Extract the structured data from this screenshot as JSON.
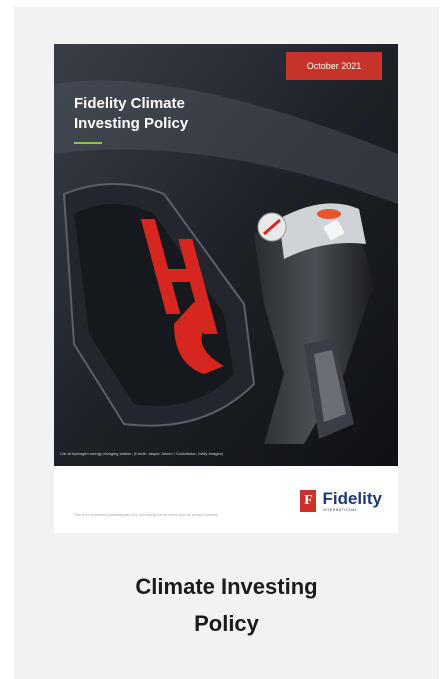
{
  "document": {
    "date_badge": "October 2021",
    "cover_title_line1": "Fidelity Climate",
    "cover_title_line2": "Investing Policy",
    "photo_credit": "Car at hydrogen energy charging station. (Credit: Jasper Juinen / Contributor, Getty Images)",
    "disclaimer": "This is for investment professionals only and should not be relied upon by private investors",
    "logo": {
      "mark": "F",
      "word": "Fidelity",
      "sub": "INTERNATIONAL"
    },
    "cover_image_text": "H2"
  },
  "caption": {
    "line1": "Climate Investing",
    "line2": "Policy"
  },
  "colors": {
    "badge": "#c7332a",
    "accent_rule": "#8dc63f",
    "logo_red": "#d12f2a",
    "logo_blue": "#1f3b73",
    "card_bg": "#f2f2f2"
  }
}
